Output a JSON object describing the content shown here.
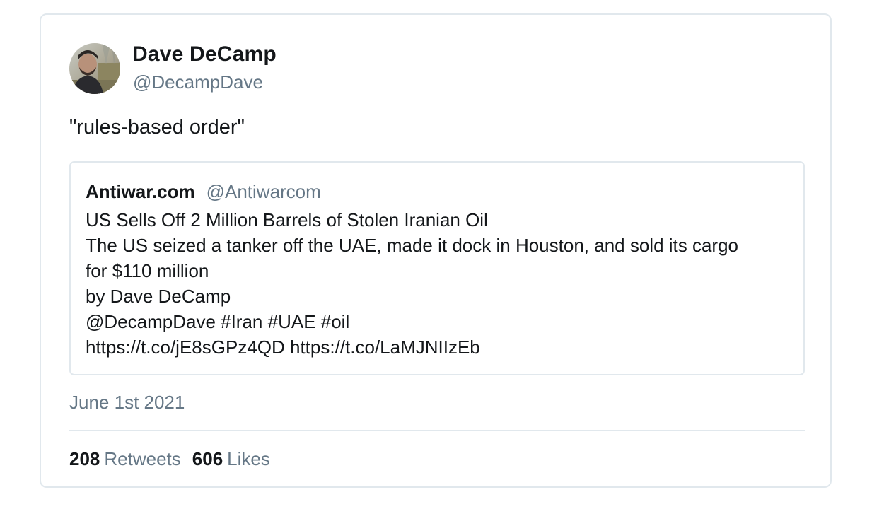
{
  "tweet": {
    "author": {
      "name": "Dave DeCamp",
      "handle": "@DecampDave",
      "avatar": "profile-photo"
    },
    "text": "\"rules-based order\"",
    "quoted": {
      "name": "Antiwar.com",
      "handle": "@Antiwarcom",
      "lines": [
        "US Sells Off 2 Million Barrels of Stolen Iranian Oil",
        "The US seized a tanker off the UAE, made it dock in Houston, and sold its cargo",
        "for $110 million",
        "by Dave DeCamp",
        "@DecampDave #Iran #UAE #oil",
        "https://t.co/jE8sGPz4QD https://t.co/LaMJNIIzEb"
      ]
    },
    "date": "June 1st 2021",
    "stats": {
      "retweets_count": "208",
      "retweets_label": "Retweets",
      "likes_count": "606",
      "likes_label": "Likes"
    }
  },
  "colors": {
    "text_primary": "#14171a",
    "text_secondary": "#657786",
    "border": "#e1e8ed"
  }
}
